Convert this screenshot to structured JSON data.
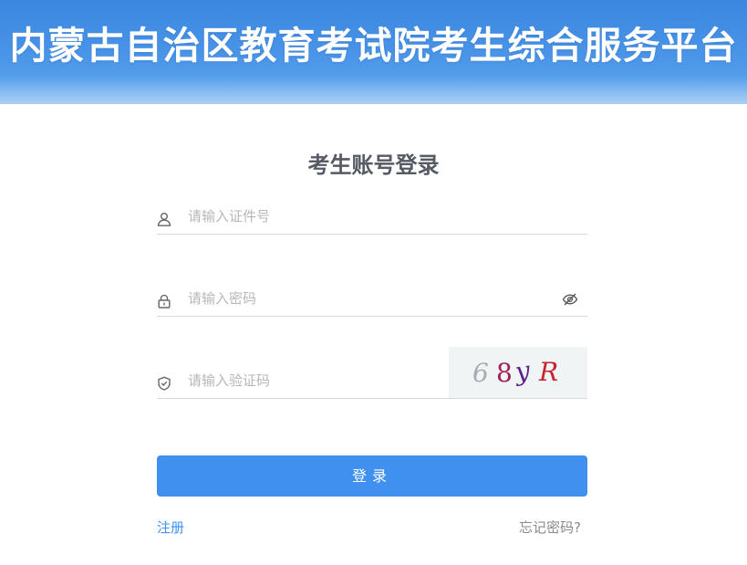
{
  "header": {
    "title": "内蒙古自治区教育考试院考生综合服务平台"
  },
  "login": {
    "title": "考生账号登录",
    "id_field": {
      "placeholder": "请输入证件号",
      "value": "",
      "icon": "user-icon"
    },
    "password_field": {
      "placeholder": "请输入密码",
      "value": "",
      "icon": "lock-icon",
      "toggle_icon": "eye-off-icon"
    },
    "captcha_field": {
      "placeholder": "请输入验证码",
      "value": "",
      "icon": "shield-icon"
    },
    "captcha": {
      "chars": [
        "6",
        "8",
        "y",
        "R"
      ],
      "colors": [
        "#a9a9b3",
        "#a0205a",
        "#5a1f8a",
        "#c8222e"
      ]
    },
    "submit_label": "登录",
    "register_label": "注册",
    "forgot_label": "忘记密码?"
  },
  "colors": {
    "accent": "#3f90ef",
    "header_bg": "#4a95e8"
  }
}
